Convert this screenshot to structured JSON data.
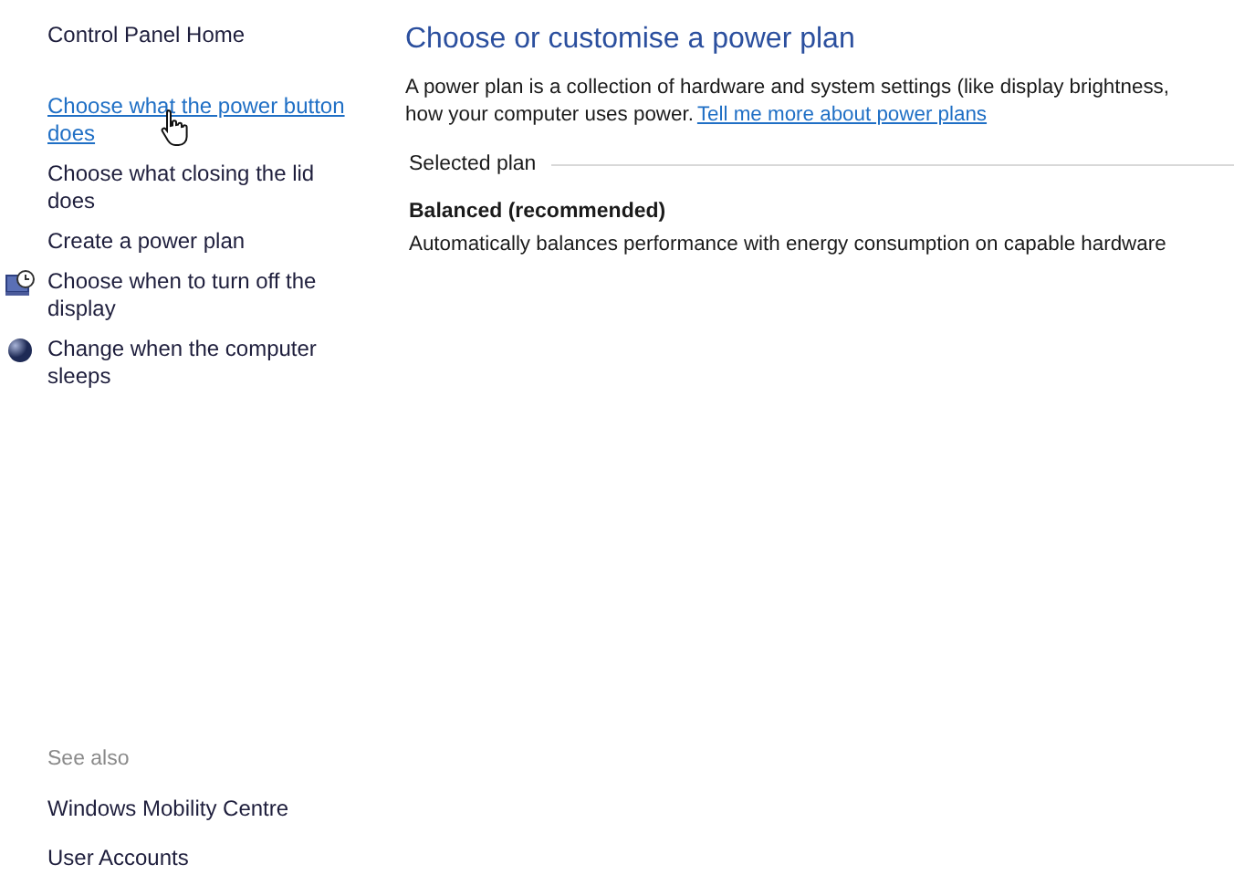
{
  "sidebar": {
    "home": "Control Panel Home",
    "items": [
      {
        "label": "Choose what the power button does",
        "kind": "link",
        "hovered": true
      },
      {
        "label": "Choose what closing the lid does",
        "kind": "link",
        "hovered": false
      },
      {
        "label": "Create a power plan",
        "kind": "link",
        "hovered": false
      },
      {
        "label": "Choose when to turn off the display",
        "kind": "display-timer",
        "hovered": false
      },
      {
        "label": "Change when the computer sleeps",
        "kind": "sleep",
        "hovered": false
      }
    ],
    "see_also": {
      "heading": "See also",
      "links": [
        "Windows Mobility Centre",
        "User Accounts"
      ]
    }
  },
  "main": {
    "title": "Choose or customise a power plan",
    "description": "A power plan is a collection of hardware and system settings (like display brightness,",
    "description_line_2": "how your computer uses power.",
    "more_link": "Tell me more about power plans",
    "section": "Selected plan",
    "plan": {
      "name": "Balanced (recommended)",
      "description": "Automatically balances performance with energy consumption on capable hardware"
    }
  }
}
